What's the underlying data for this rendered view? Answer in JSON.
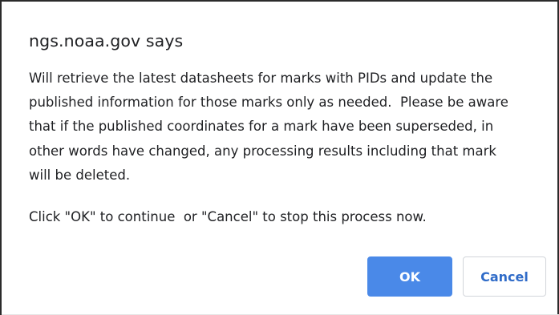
{
  "dialog": {
    "title": "ngs.noaa.gov says",
    "message_lines": [
      "Will retrieve the latest datasheets for marks with PIDs and update the",
      "published information for those marks only as needed.  Please be aware",
      "that if the published coordinates for a mark have been superseded, in",
      "other words have changed, any processing results including that mark",
      "will be deleted.",
      "Click \"OK\" to continue  or \"Cancel\" to stop this process now."
    ],
    "buttons": {
      "ok_label": "OK",
      "cancel_label": "Cancel"
    }
  },
  "colors": {
    "ok_button_bg": "#4a89e8",
    "cancel_text": "#2f6bc8",
    "text": "#202124"
  }
}
